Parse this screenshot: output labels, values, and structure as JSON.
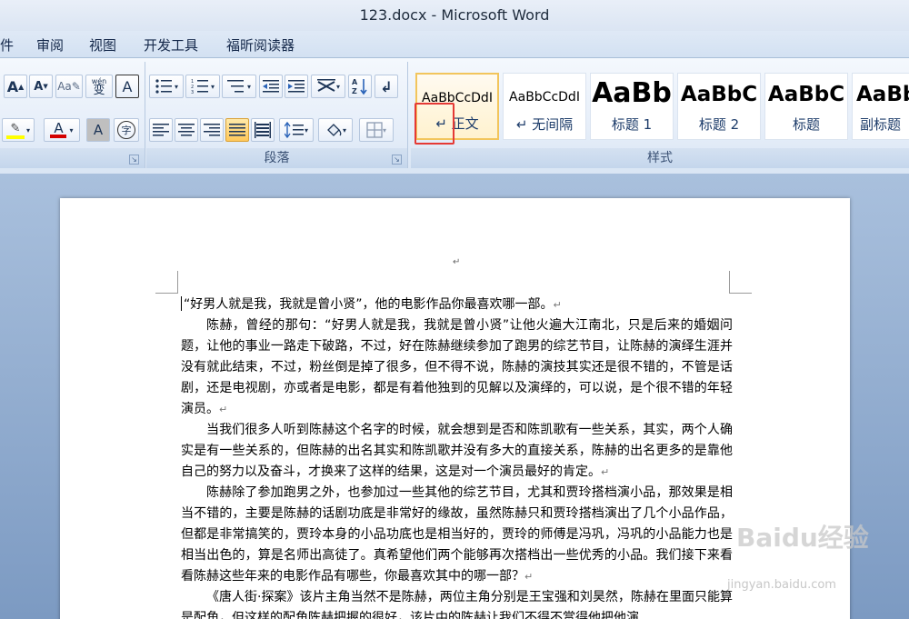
{
  "window": {
    "title": "123.docx - Microsoft Word"
  },
  "menu": {
    "tabs": [
      "件",
      "审阅",
      "视图",
      "开发工具",
      "福昕阅读器"
    ]
  },
  "ribbon": {
    "font_group": {
      "grow_font": "A",
      "shrink_font": "A",
      "phonetic": "wén",
      "phonetic_char": "变",
      "char_border": "A",
      "font_color": "A",
      "char_shading": "A",
      "enclose": "字"
    },
    "paragraph_group": {
      "label": "段落"
    },
    "styles_group": {
      "label": "样式",
      "tiles": [
        {
          "sample": "AaBbCcDdI",
          "name": "↵ 正文",
          "active": true
        },
        {
          "sample": "AaBbCcDdI",
          "name": "↵ 无间隔",
          "active": false
        },
        {
          "sample": "AaBb",
          "name": "标题 1",
          "active": false
        },
        {
          "sample": "AaBbC",
          "name": "标题 2",
          "active": false
        },
        {
          "sample": "AaBbC",
          "name": "标题",
          "active": false
        },
        {
          "sample": "AaBb",
          "name": "副标题",
          "active": false
        }
      ]
    }
  },
  "document": {
    "top_mark": "↵",
    "paragraphs": [
      {
        "text": "“好男人就是我，我就是曾小贤”，他的电影作品你最喜欢哪一部。",
        "mark": "↵",
        "caret": true
      },
      {
        "text": "陈赫，曾经的那句：“好男人就是我，我就是曾小贤”让他火遍大江南北，只是后来的婚姻问题，让他的事业一路走下破路，不过，好在陈赫继续参加了跑男的综艺节目，让陈赫的演绎生涯并没有就此结束，不过，粉丝倒是掉了很多，但不得不说，陈赫的演技其实还是很不错的，不管是话剧，还是电视剧，亦或者是电影，都是有着他独到的见解以及演绎的，可以说，是个很不错的年轻演员。",
        "mark": "↵"
      },
      {
        "text": "当我们很多人听到陈赫这个名字的时候，就会想到是否和陈凯歌有一些关系，其实，两个人确实是有一些关系的，但陈赫的出名其实和陈凯歌并没有多大的直接关系，陈赫的出名更多的是靠他自己的努力以及奋斗，才换来了这样的结果，这是对一个演员最好的肯定。",
        "mark": "↵"
      },
      {
        "text": "陈赫除了参加跑男之外，也参加过一些其他的综艺节目，尤其和贾玲搭档演小品，那效果是相当不错的，主要是陈赫的话剧功底是非常好的缘故，虽然陈赫只和贾玲搭档演出了几个小品作品，但都是非常搞笑的，贾玲本身的小品功底也是相当好的，贾玲的师傅是冯巩，冯巩的小品能力也是相当出色的，算是名师出高徒了。真希望他们两个能够再次搭档出一些优秀的小品。我们接下来看看陈赫这些年来的电影作品有哪些，你最喜欢其中的哪一部？",
        "mark": "↵"
      },
      {
        "text": "《唐人街·探案》该片主角当然不是陈赫，两位主角分别是王宝强和刘昊然，陈赫在里面只能算是配角，但这样的配角陈赫把握的很好，该片中的陈赫让我们不得不赏得他把他演",
        "mark": ""
      }
    ]
  },
  "watermark": {
    "text": "Baidu经验",
    "url": "jingyan.baidu.com"
  },
  "colors": {
    "highlight": "#e53935",
    "font_color_bar": "#d40000",
    "highlighter_bar": "#ffff00",
    "active_style_border": "#f2c55c"
  }
}
